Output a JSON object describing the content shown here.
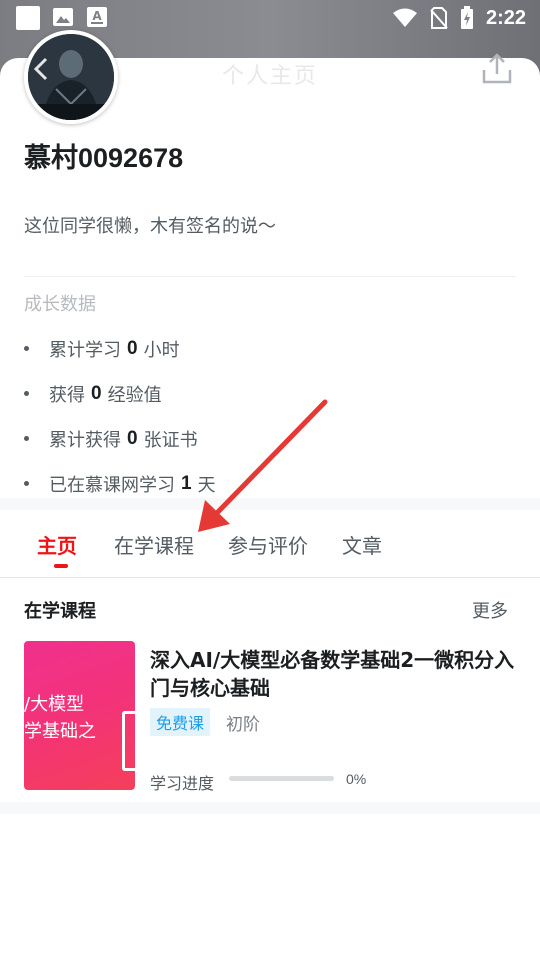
{
  "status_bar": {
    "time": "2:22",
    "icons": [
      "notification-square-icon",
      "image-icon",
      "font-icon",
      "wifi-icon",
      "no-sim-icon",
      "battery-charging-icon"
    ]
  },
  "header": {
    "title": "个人主页",
    "back_icon": "chevron-left-icon",
    "share_icon": "share-icon"
  },
  "profile": {
    "username": "慕村0092678",
    "signature": "这位同学很懒，木有签名的说～"
  },
  "growth": {
    "title": "成长数据",
    "stats": [
      {
        "prefix": "累计学习",
        "value": "0",
        "suffix": "小时"
      },
      {
        "prefix": "获得",
        "value": "0",
        "suffix": "经验值"
      },
      {
        "prefix": "累计获得",
        "value": "0",
        "suffix": "张证书"
      },
      {
        "prefix": "已在慕课网学习",
        "value": "1",
        "suffix": "天"
      }
    ]
  },
  "tabs": [
    {
      "label": "主页",
      "active": true
    },
    {
      "label": "在学课程",
      "active": false
    },
    {
      "label": "参与评价",
      "active": false
    },
    {
      "label": "文章",
      "active": false
    }
  ],
  "learning": {
    "title": "在学课程",
    "more": "更多",
    "course": {
      "thumb_lines": [
        "/大模型",
        "学基础之"
      ],
      "title": "深入AI/大模型必备数学基础2一微积分入门与核心基础",
      "tag": "免费课",
      "level": "初阶",
      "progress_label": "学习进度",
      "progress_value": 0,
      "progress_text": "0%"
    }
  },
  "colors": {
    "accent_red": "#f01414",
    "tag_blue": "#1a9ee8",
    "annotation_arrow": "#e53935"
  }
}
